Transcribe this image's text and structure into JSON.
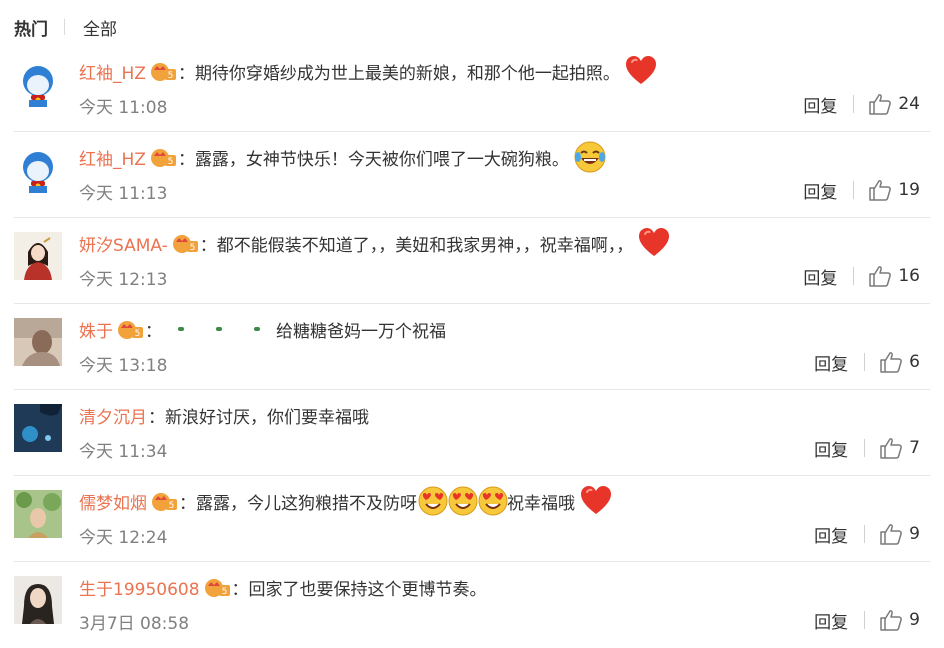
{
  "tabs": {
    "hot": "热门",
    "all": "全部"
  },
  "actions": {
    "reply_label": "回复"
  },
  "comments": [
    {
      "user": "红袖_HZ",
      "colon": "：",
      "text": "期待你穿婚纱成为世上最美的新娘，和那个他一起拍照。",
      "time": "今天 11:08",
      "likes": "24"
    },
    {
      "user": "红袖_HZ",
      "colon": "：",
      "text": "露露，女神节快乐！今天被你们喂了一大碗狗粮。",
      "time": "今天 11:13",
      "likes": "19"
    },
    {
      "user": "妍汐SAMA-",
      "colon": "：",
      "text": "都不能假装不知道了，，美妞和我家男神，，祝幸福啊，，",
      "time": "今天 12:13",
      "likes": "16"
    },
    {
      "user": "姝于",
      "colon": "：",
      "text": "给糖糖爸妈一万个祝福",
      "time": "今天 13:18",
      "likes": "6"
    },
    {
      "user": "清夕沉月",
      "colon": "：",
      "text": "新浪好讨厌，你们要幸福哦",
      "time": "今天 11:34",
      "likes": "7"
    },
    {
      "user": "儒梦如烟",
      "colon": "：",
      "text": "露露，今儿这狗粮措不及防呀",
      "text2": "祝幸福哦",
      "time": "今天 12:24",
      "likes": "9"
    },
    {
      "user": "生于19950608",
      "colon": "：",
      "text": "回家了也要保持这个更博节奏。",
      "time": "3月7日 08:58",
      "likes": "9"
    }
  ],
  "colors": {
    "username": "#eb7350",
    "text": "#333333",
    "time": "#808080",
    "divider": "#e6e6e6",
    "vip_badge": "#f2a23a"
  },
  "icons": {
    "vip": "vip-crown-badge-icon",
    "like": "thumbs-up-icon",
    "heart": "heart-emoji-icon",
    "laugh": "laughing-tears-emoji-icon",
    "heart_eyes": "heart-eyes-emoji-icon"
  }
}
